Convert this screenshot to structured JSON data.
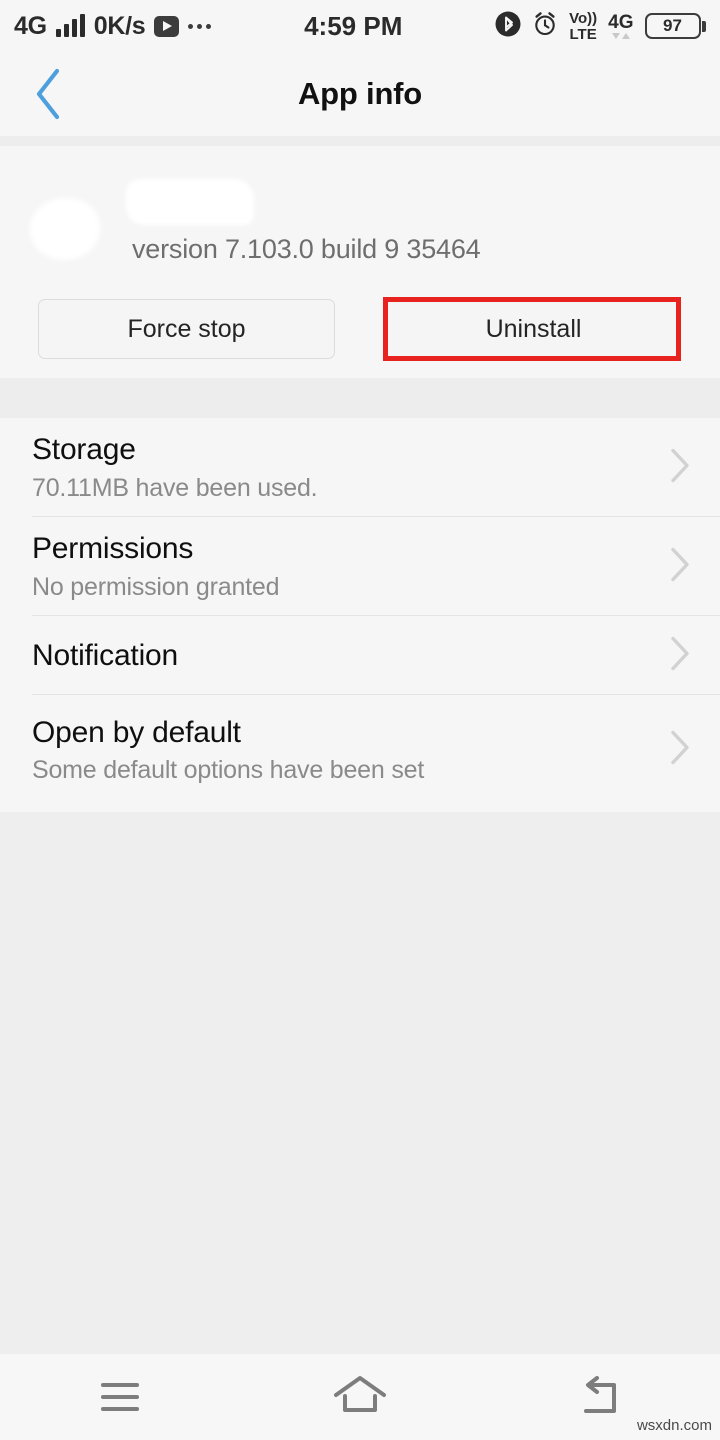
{
  "statusbar": {
    "network_type": "4G",
    "data_rate": "0K/s",
    "clock": "4:59 PM",
    "volte_top": "Vo))",
    "volte_bottom": "LTE",
    "network_type_right": "4G",
    "battery_level": "97",
    "icons": {
      "signal": "signal-bars-icon",
      "play": "play-icon",
      "overflow": "more-dots-icon",
      "bluetooth": "bluetooth-icon",
      "alarm": "alarm-clock-icon"
    }
  },
  "appbar": {
    "title": "App info",
    "back_icon": "back-chevron-icon",
    "back_color": "#4e9fdd"
  },
  "app_header": {
    "app_name": "",
    "version": "version 7.103.0 build 9 35464"
  },
  "actions": {
    "force_stop_label": "Force stop",
    "uninstall_label": "Uninstall",
    "highlight_color": "#e8231f"
  },
  "list": {
    "rows": [
      {
        "title": "Storage",
        "subtitle": "70.11MB have been used.",
        "chevron": "chevron-right-icon"
      },
      {
        "title": "Permissions",
        "subtitle": "No permission granted",
        "chevron": "chevron-right-icon"
      },
      {
        "title": "Notification",
        "subtitle": "",
        "chevron": "chevron-right-icon"
      },
      {
        "title": "Open by default",
        "subtitle": "Some default options have been set",
        "chevron": "chevron-right-icon"
      }
    ]
  },
  "navbar": {
    "menu_icon": "menu-icon",
    "home_icon": "home-icon",
    "back_icon": "back-arrow-icon"
  },
  "watermark": {
    "text": "wsxdn.com"
  }
}
